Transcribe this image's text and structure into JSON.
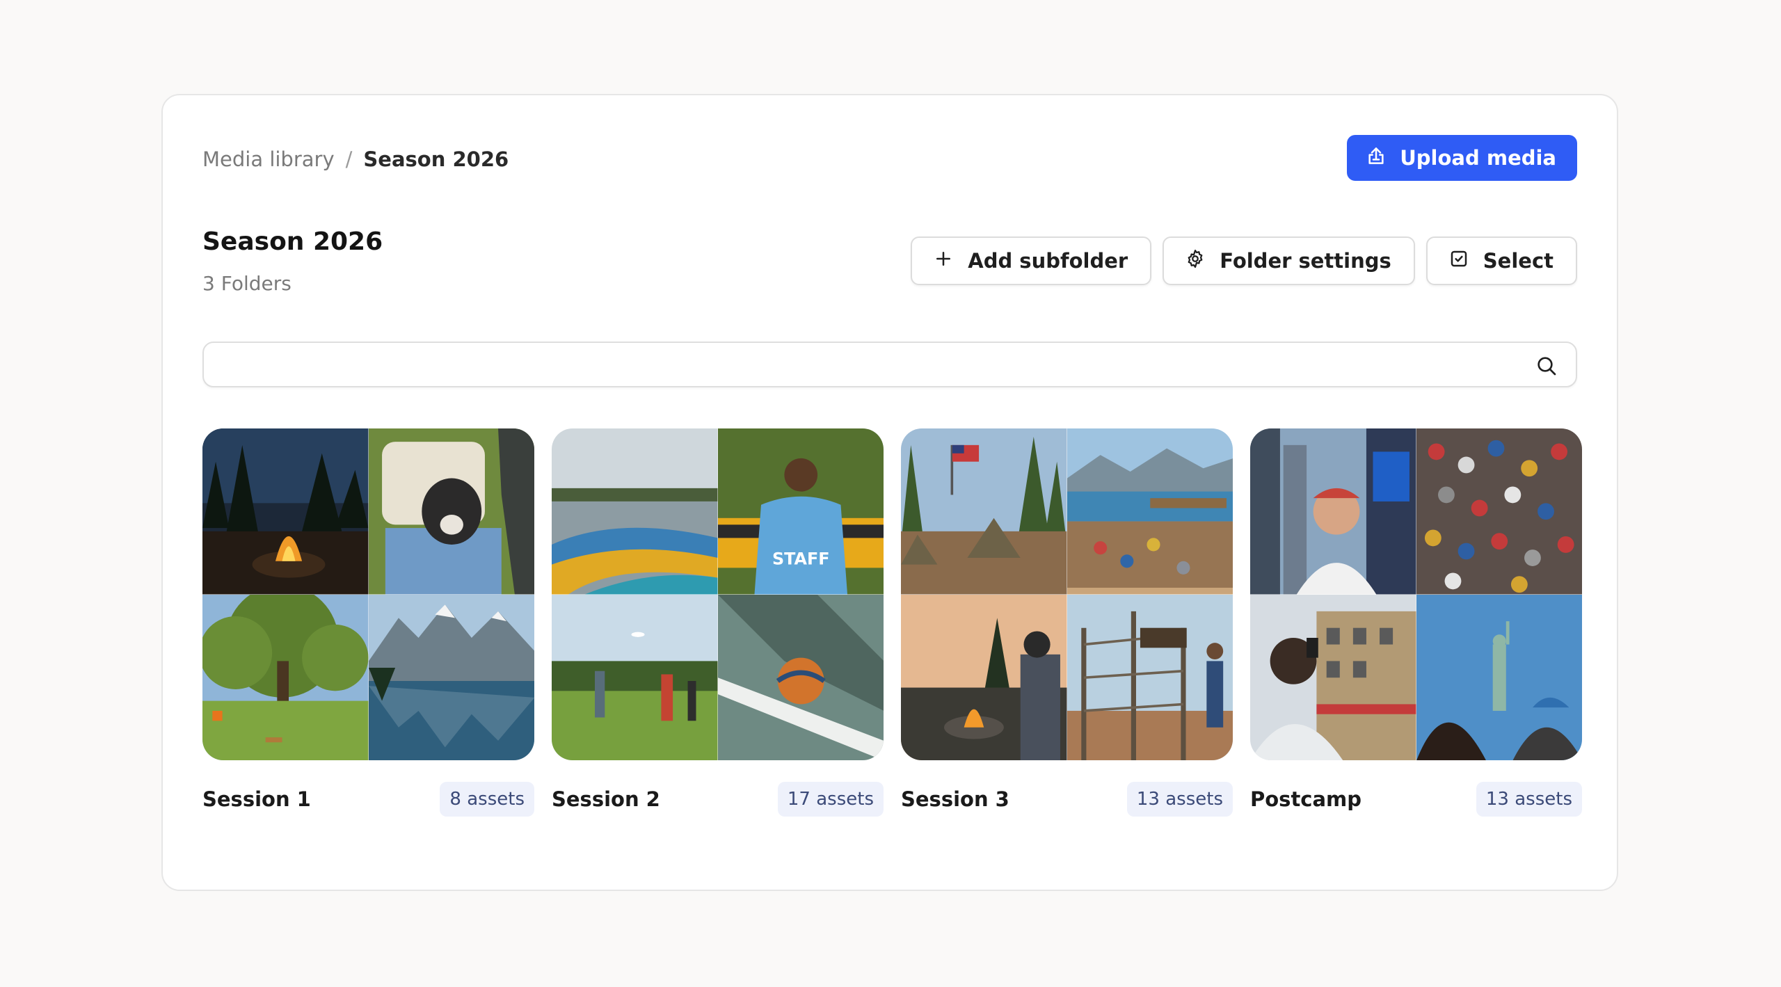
{
  "breadcrumb": {
    "root": "Media library",
    "separator": "/",
    "current": "Season 2026"
  },
  "upload_button": {
    "label": "Upload media",
    "icon": "upload-icon",
    "color": "#2f5cf5"
  },
  "folder": {
    "title": "Season 2026",
    "count": "3 Folders"
  },
  "actions": {
    "add_subfolder": {
      "label": "Add subfolder",
      "icon": "plus-icon"
    },
    "folder_settings": {
      "label": "Folder settings",
      "icon": "gear-icon"
    },
    "select": {
      "label": "Select",
      "icon": "checkbox-icon"
    }
  },
  "search": {
    "placeholder": "",
    "value": "",
    "icon": "search-icon"
  },
  "subfolders": [
    {
      "name": "Session 1",
      "assets": "8 assets",
      "tiles": [
        "campfire-night",
        "dog-golf-cart",
        "picnic-tree-meadow",
        "mountain-lake"
      ]
    },
    {
      "name": "Session 2",
      "assets": "17 assets",
      "tiles": [
        "kayaks-lake",
        "staff-shirt-bus",
        "frisbee-field",
        "basketball-court"
      ]
    },
    {
      "name": "Session 3",
      "assets": "13 assets",
      "tiles": [
        "flag-campsite",
        "love-locks-lake",
        "campfire-sunset",
        "ropes-course"
      ]
    },
    {
      "name": "Postcamp",
      "assets": "13 assets",
      "tiles": [
        "times-square-selfie",
        "love-locks-wall",
        "city-phone-photo",
        "statue-of-liberty"
      ]
    }
  ]
}
